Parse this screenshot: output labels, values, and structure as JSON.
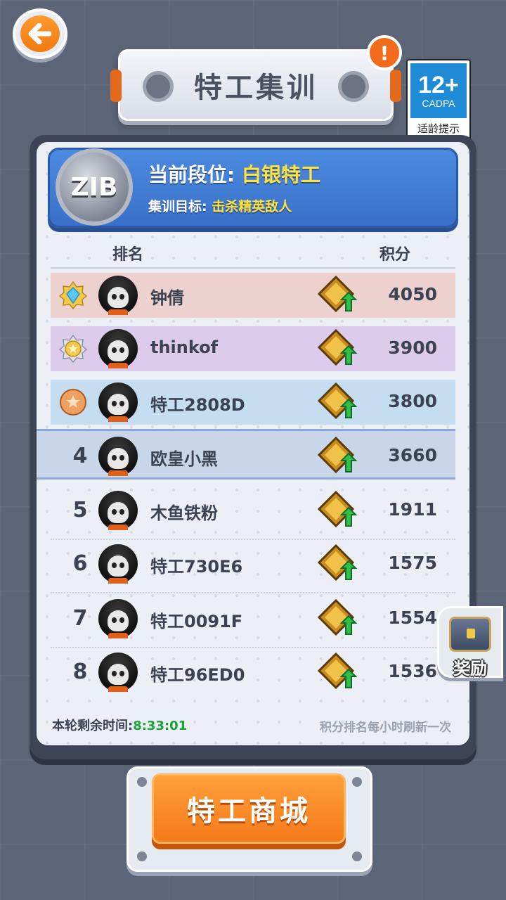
{
  "header": {
    "title": "特工集训",
    "alert_mark": "!"
  },
  "age_rating": {
    "number": "12+",
    "org": "CADPA",
    "hint": "适龄提示"
  },
  "rank_card": {
    "emblem_text": "ZIB",
    "current_label": "当前段位: ",
    "current_value": "白银特工",
    "goal_label": "集训目标: ",
    "goal_value": "击杀精英敌人"
  },
  "table": {
    "col_rank": "排名",
    "col_score": "积分",
    "rows": [
      {
        "rank": "1",
        "name": "钟倩",
        "score": "4050"
      },
      {
        "rank": "2",
        "name": "thinkof",
        "score": "3900"
      },
      {
        "rank": "3",
        "name": "特工2808D",
        "score": "3800"
      },
      {
        "rank": "4",
        "name": "欧皇小黑",
        "score": "3660"
      },
      {
        "rank": "5",
        "name": "木鱼铁粉",
        "score": "1911"
      },
      {
        "rank": "6",
        "name": "特工730E6",
        "score": "1575"
      },
      {
        "rank": "7",
        "name": "特工0091F",
        "score": "1554"
      },
      {
        "rank": "8",
        "name": "特工96ED0",
        "score": "1536"
      }
    ]
  },
  "footer": {
    "remaining_label": "本轮剩余时间:",
    "remaining_time": "8:33:01",
    "refresh_note": "积分排名每小时刷新一次"
  },
  "reward": {
    "label": "奖励"
  },
  "shop": {
    "label": "特工商城"
  },
  "colors": {
    "accent_orange": "#f5791a",
    "rank_blue": "#3970c8",
    "highlight_yellow": "#ffe23a",
    "timer_green": "#1aa33a"
  }
}
